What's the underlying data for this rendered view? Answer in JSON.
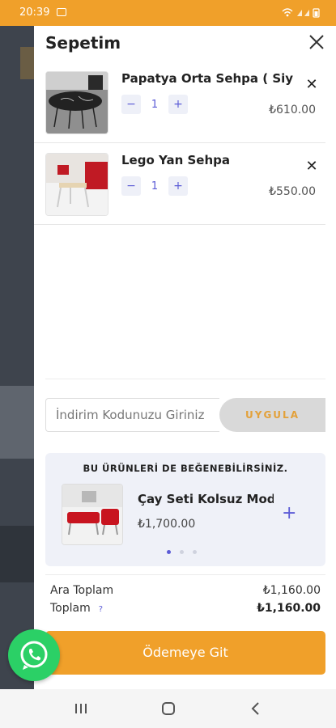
{
  "status_bar": {
    "time": "20:39"
  },
  "cart": {
    "title": "Sepetim",
    "items": [
      {
        "name": "Papatya Orta Sehpa ( Siyah )",
        "quantity": "1",
        "price": "₺610.00"
      },
      {
        "name": "Lego Yan Sehpa",
        "quantity": "1",
        "price": "₺550.00"
      }
    ],
    "coupon": {
      "placeholder": "İndirim Kodunuzu Giriniz",
      "apply_label": "UYGULA"
    },
    "recommend": {
      "title": "BU ÜRÜNLERİ DE BEĞENEBİLİRSİNİZ.",
      "product_name": "Çay Seti Kolsuz Model",
      "product_price": "₺1,700.00",
      "page_dots": 3,
      "active_dot": 1
    },
    "totals": {
      "subtotal_label": "Ara Toplam",
      "subtotal": "₺1,160.00",
      "total_label": "Toplam",
      "total": "₺1,160.00",
      "help_mark": "?"
    },
    "checkout_label": "Ödemeye Git"
  },
  "colors": {
    "accent": "#f0a02a",
    "brand_purple": "#5b5bd6",
    "whatsapp": "#2bd066"
  }
}
